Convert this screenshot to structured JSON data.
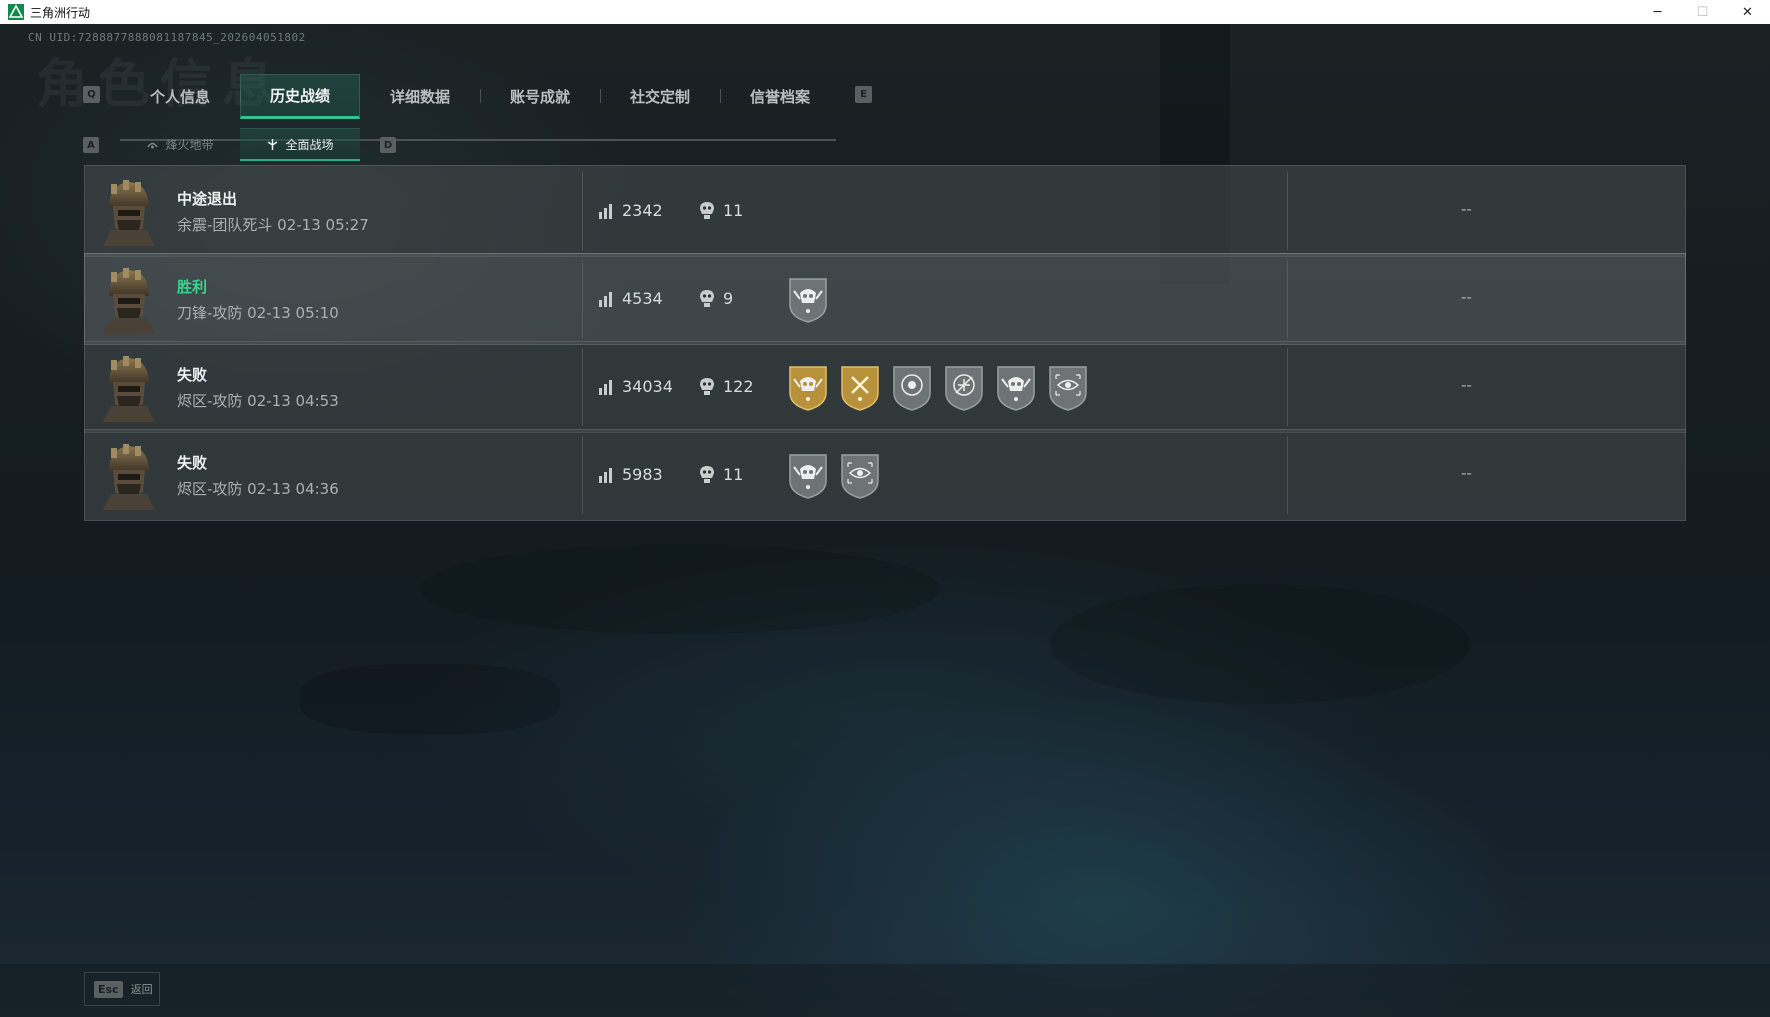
{
  "window": {
    "title": "三角洲行动",
    "icons": {
      "app": "delta-logo-icon",
      "minimize": "minimize-icon",
      "maximize": "maximize-icon",
      "close": "close-icon"
    }
  },
  "header": {
    "uid": "CN UID:7288877888081187845_202604051802",
    "ghost_title": "角色信息"
  },
  "tabs": {
    "left_key": "Q",
    "right_key": "E",
    "items": [
      {
        "label": "个人信息",
        "active": false
      },
      {
        "label": "历史战绩",
        "active": true
      },
      {
        "label": "详细数据",
        "active": false
      },
      {
        "label": "账号成就",
        "active": false
      },
      {
        "label": "社交定制",
        "active": false
      },
      {
        "label": "信誉档案",
        "active": false
      }
    ]
  },
  "subtabs": {
    "left_key": "A",
    "right_key": "D",
    "items": [
      {
        "label": "烽火地带",
        "icon": "extraction-icon",
        "active": false
      },
      {
        "label": "全面战场",
        "icon": "battlefield-icon",
        "active": true
      }
    ]
  },
  "records": [
    {
      "result": "中途退出",
      "result_type": "quit",
      "mode": "余震-团队死斗 02-13 05:27",
      "score": "2342",
      "kills": "11",
      "badges": [],
      "extra": "--",
      "highlight": false
    },
    {
      "result": "胜利",
      "result_type": "win",
      "mode": "刀锋-攻防 02-13 05:10",
      "score": "4534",
      "kills": "9",
      "badges": [
        "wing-skull-badge-icon"
      ],
      "extra": "--",
      "highlight": true
    },
    {
      "result": "失败",
      "result_type": "lose",
      "mode": "烬区-攻防 02-13 04:53",
      "score": "34034",
      "kills": "122",
      "badges": [
        "gold-laurel-skull-badge-icon",
        "gold-crossed-axes-badge-icon",
        "skull-target-badge-icon",
        "no-aircraft-badge-icon",
        "wing-skull-badge-icon",
        "eye-scope-badge-icon"
      ],
      "extra": "--",
      "highlight": false
    },
    {
      "result": "失败",
      "result_type": "lose",
      "mode": "烬区-攻防 02-13 04:36",
      "score": "5983",
      "kills": "11",
      "badges": [
        "wing-skull-badge-icon",
        "eye-scope-badge-icon"
      ],
      "extra": "--",
      "highlight": false
    }
  ],
  "colors": {
    "accent": "#33c28e",
    "win": "#3ad48e",
    "badge_gold": "#b8923a",
    "badge_silver": "#6e7476"
  },
  "footer": {
    "esc_key": "Esc",
    "back_label": "返回"
  }
}
